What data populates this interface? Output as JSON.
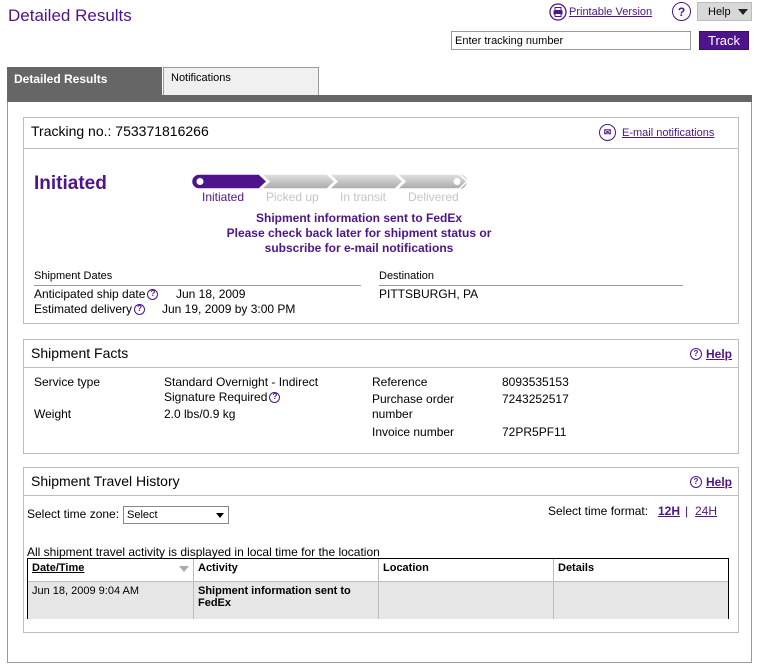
{
  "header": {
    "title": "Detailed Results",
    "printable_label": "Printable Version",
    "help_label": "Help",
    "tracking_placeholder": "Enter tracking number",
    "track_label": "Track"
  },
  "tabs": [
    {
      "label": "Detailed Results",
      "active": true
    },
    {
      "label": "Notifications",
      "active": false
    }
  ],
  "tracking": {
    "number_text": "Tracking no.: 753371816266",
    "email_label": "E-mail notifications",
    "status": "Initiated",
    "steps": [
      "Initiated",
      "Picked up",
      "In transit",
      "Delivered"
    ],
    "message_lines": [
      "Shipment information sent to FedEx",
      "Please check back later for shipment status or",
      "subscribe for e-mail notifications"
    ],
    "dates_heading": "Shipment Dates",
    "anticipated_label": "Anticipated ship date",
    "anticipated_value": "Jun 18, 2009",
    "estimated_label": "Estimated delivery",
    "estimated_value": "Jun 19, 2009 by 3:00 PM",
    "destination_heading": "Destination",
    "destination_value": "PITTSBURGH, PA"
  },
  "facts": {
    "title": "Shipment Facts",
    "help_label": "Help",
    "service_type_label": "Service type",
    "service_type_value_1": "Standard Overnight - Indirect",
    "service_type_value_2": "Signature Required",
    "weight_label": "Weight",
    "weight_value": "2.0 lbs/0.9 kg",
    "reference_label": "Reference",
    "reference_value": "8093535153",
    "po_label_1": "Purchase order",
    "po_label_2": "number",
    "po_value": "7243252517",
    "invoice_label": "Invoice number",
    "invoice_value": "72PR5PF11"
  },
  "history": {
    "title": "Shipment Travel History",
    "help_label": "Help",
    "tz_label": "Select time zone:",
    "tz_value": "Select",
    "format_label": "Select time format:",
    "format_12": "12H",
    "format_sep": "|",
    "format_24": "24H",
    "note": "All shipment travel activity is displayed in local time for the location",
    "columns": [
      "Date/Time",
      "Activity",
      "Location",
      "Details"
    ],
    "rows": [
      {
        "datetime": "Jun 18, 2009 9:04 AM",
        "activity_1": "Shipment information sent to",
        "activity_2": "FedEx",
        "location": "",
        "details": ""
      }
    ]
  },
  "colors": {
    "brand_purple": "#4d148c",
    "tab_gray": "#666666",
    "row_gray": "#e6e6e6"
  }
}
